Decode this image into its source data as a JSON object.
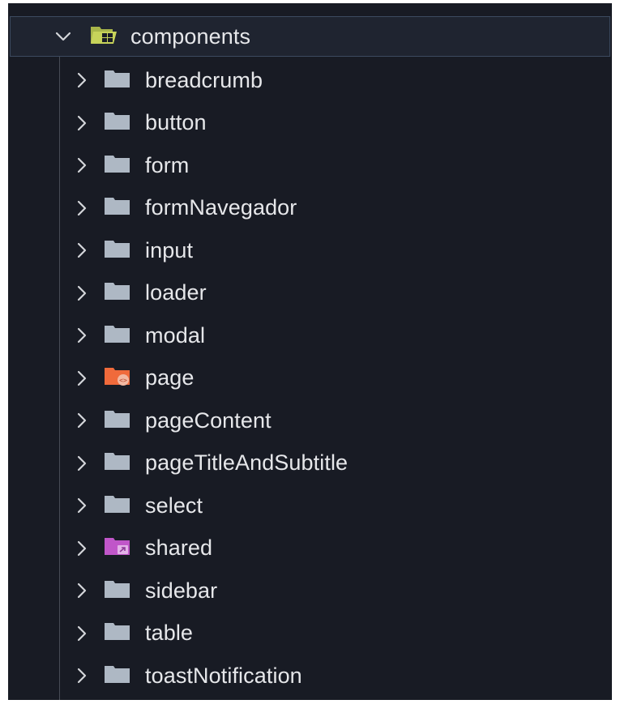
{
  "explorer": {
    "root": {
      "label": "components",
      "icon": "folder-components-open-icon",
      "icon_color": "#c7d35a",
      "expanded": true
    },
    "items": [
      {
        "label": "breadcrumb",
        "icon": "folder-icon",
        "color": "#aeb8c4"
      },
      {
        "label": "button",
        "icon": "folder-icon",
        "color": "#aeb8c4"
      },
      {
        "label": "form",
        "icon": "folder-icon",
        "color": "#aeb8c4"
      },
      {
        "label": "formNavegador",
        "icon": "folder-icon",
        "color": "#aeb8c4"
      },
      {
        "label": "input",
        "icon": "folder-icon",
        "color": "#aeb8c4"
      },
      {
        "label": "loader",
        "icon": "folder-icon",
        "color": "#aeb8c4"
      },
      {
        "label": "modal",
        "icon": "folder-icon",
        "color": "#aeb8c4"
      },
      {
        "label": "page",
        "icon": "folder-html-icon",
        "color": "#f06a3b"
      },
      {
        "label": "pageContent",
        "icon": "folder-icon",
        "color": "#aeb8c4"
      },
      {
        "label": "pageTitleAndSubtitle",
        "icon": "folder-icon",
        "color": "#aeb8c4"
      },
      {
        "label": "select",
        "icon": "folder-icon",
        "color": "#aeb8c4"
      },
      {
        "label": "shared",
        "icon": "folder-shared-icon",
        "color": "#c056c9"
      },
      {
        "label": "sidebar",
        "icon": "folder-icon",
        "color": "#aeb8c4"
      },
      {
        "label": "table",
        "icon": "folder-icon",
        "color": "#aeb8c4"
      },
      {
        "label": "toastNotification",
        "icon": "folder-icon",
        "color": "#aeb8c4"
      }
    ]
  }
}
